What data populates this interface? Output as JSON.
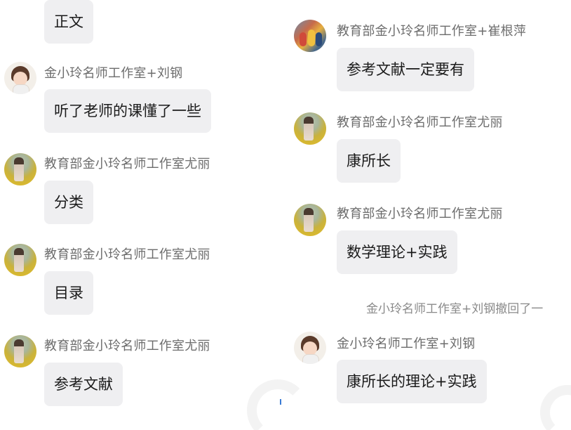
{
  "left_column": {
    "top_bubble": {
      "text": "正文"
    },
    "messages": [
      {
        "sender": "金小玲名师工作室+刘钢",
        "text": "听了老师的课懂了一些",
        "avatar": "cartoon-avatar"
      },
      {
        "sender": "教育部金小玲名师工作室尤丽",
        "text": "分类",
        "avatar": "field-photo-avatar"
      },
      {
        "sender": "教育部金小玲名师工作室尤丽",
        "text": "目录",
        "avatar": "field-photo-avatar"
      },
      {
        "sender": "教育部金小玲名师工作室尤丽",
        "text": "参考文献",
        "avatar": "field-photo-avatar"
      }
    ]
  },
  "right_column": {
    "messages": [
      {
        "sender": "教育部金小玲名师工作室+崔根萍",
        "text": "参考文献一定要有",
        "avatar": "group-photo-avatar"
      },
      {
        "sender": "教育部金小玲名师工作室尤丽",
        "text": "康所长",
        "avatar": "field-photo-avatar"
      },
      {
        "sender": "教育部金小玲名师工作室尤丽",
        "text": "数学理论+实践",
        "avatar": "field-photo-avatar"
      },
      {
        "sender": "金小玲名师工作室+刘钢",
        "text": "康所长的理论+实践",
        "avatar": "cartoon-avatar"
      }
    ],
    "recall_notice": "金小玲名师工作室+刘钢撤回了一"
  },
  "colors": {
    "bubble_bg": "#efeff1",
    "sender_text": "#6d6d6d",
    "message_text": "#1a1a1a"
  }
}
